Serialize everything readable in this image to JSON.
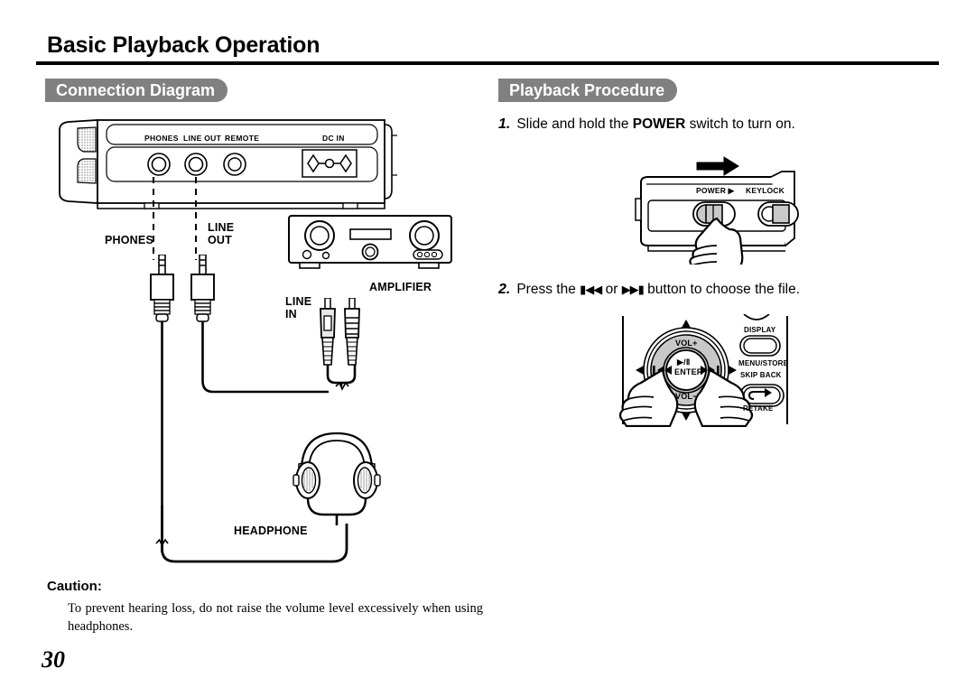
{
  "document": {
    "page_title": "Basic Playback Operation",
    "page_number": "30"
  },
  "sections": {
    "connection_diagram": {
      "heading": "Connection Diagram"
    },
    "playback_procedure": {
      "heading": "Playback Procedure"
    }
  },
  "steps": [
    {
      "number": "1.",
      "text_before": "Slide and hold the ",
      "emphasis": "POWER",
      "text_after": " switch to turn on."
    },
    {
      "number": "2.",
      "text_before": "Press the ",
      "icon_prev": "▮◀◀",
      "text_middle": " or ",
      "icon_next": "▶▶▮",
      "text_after": " button to choose the file."
    }
  ],
  "connection_figure": {
    "recorder_ports": [
      "PHONES",
      "LINE OUT",
      "REMOTE",
      "DC IN"
    ],
    "callouts": {
      "phones": "PHONES",
      "line_out": "LINE\nOUT",
      "line_in": "LINE\nIN",
      "amplifier": "AMPLIFIER",
      "headphone": "HEADPHONE"
    }
  },
  "power_figure": {
    "labels": {
      "power": "POWER ▶",
      "keylock": "KEYLOCK"
    },
    "arrow_direction": "right"
  },
  "control_pad_figure": {
    "center_button": {
      "play_pause": "▶/Ⅱ",
      "enter": "ENTER"
    },
    "ring_labels": {
      "top": "VOL+",
      "bottom": "VOL−",
      "left": "▮◀◀",
      "right": "▶▶▮"
    },
    "side_buttons": [
      "DISPLAY",
      "MENU/STORE",
      "SKIP BACK",
      "RETAKE"
    ]
  },
  "caution": {
    "heading": "Caution:",
    "body": "To prevent hearing loss, do not raise the volume level excessively when using headphones."
  },
  "colors": {
    "pill_background": "#808080",
    "pill_text": "#ffffff",
    "ink": "#000000",
    "paper": "#ffffff",
    "pad_gray": "#c8c8c8"
  }
}
